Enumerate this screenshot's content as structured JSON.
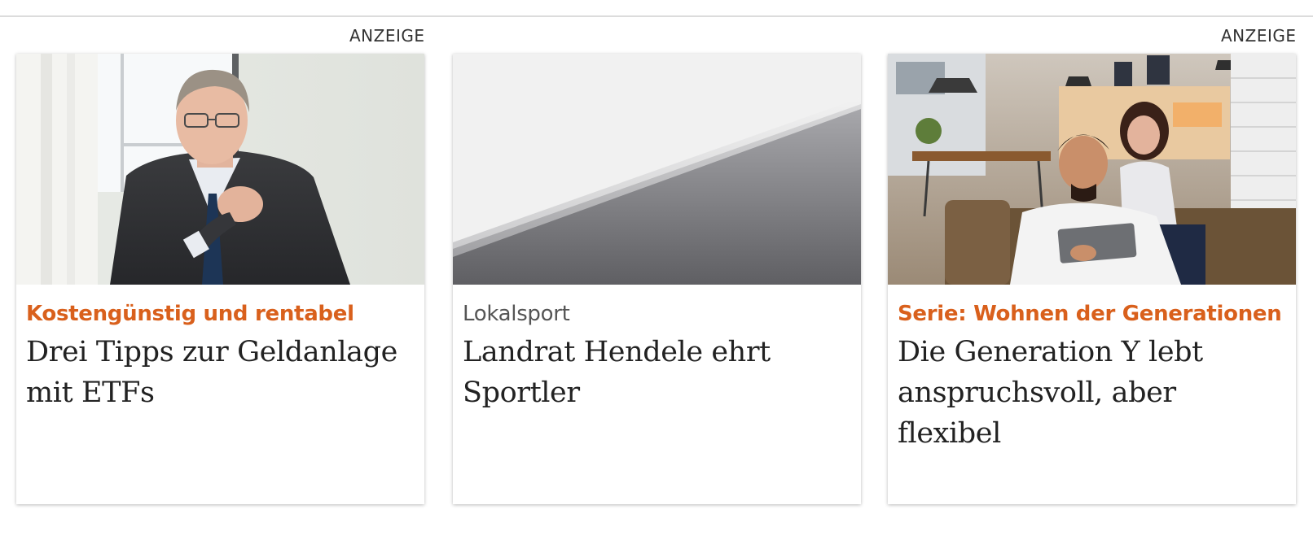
{
  "ads": {
    "left_label": "ANZEIGE",
    "right_label": "ANZEIGE"
  },
  "teasers": [
    {
      "kicker": "Kostengünstig und rentabel",
      "headline": "Drei Tipps zur Geldanlage mit ETFs",
      "image": "businessman-portrait-photo",
      "sponsored": true
    },
    {
      "kicker": "Lokalsport",
      "headline": "Landrat Hendele ehrt Sportler",
      "image": "placeholder-gradient-image",
      "sponsored": false
    },
    {
      "kicker": "Serie: Wohnen der Generationen",
      "headline": "Die Generation Y lebt anspruchsvoll, aber flexibel",
      "image": "couple-tablet-photo",
      "sponsored": true
    }
  ],
  "colors": {
    "kicker_accent": "#d9601c",
    "kicker_neutral": "#555555",
    "headline": "#222222",
    "divider": "#dcdcdc"
  }
}
